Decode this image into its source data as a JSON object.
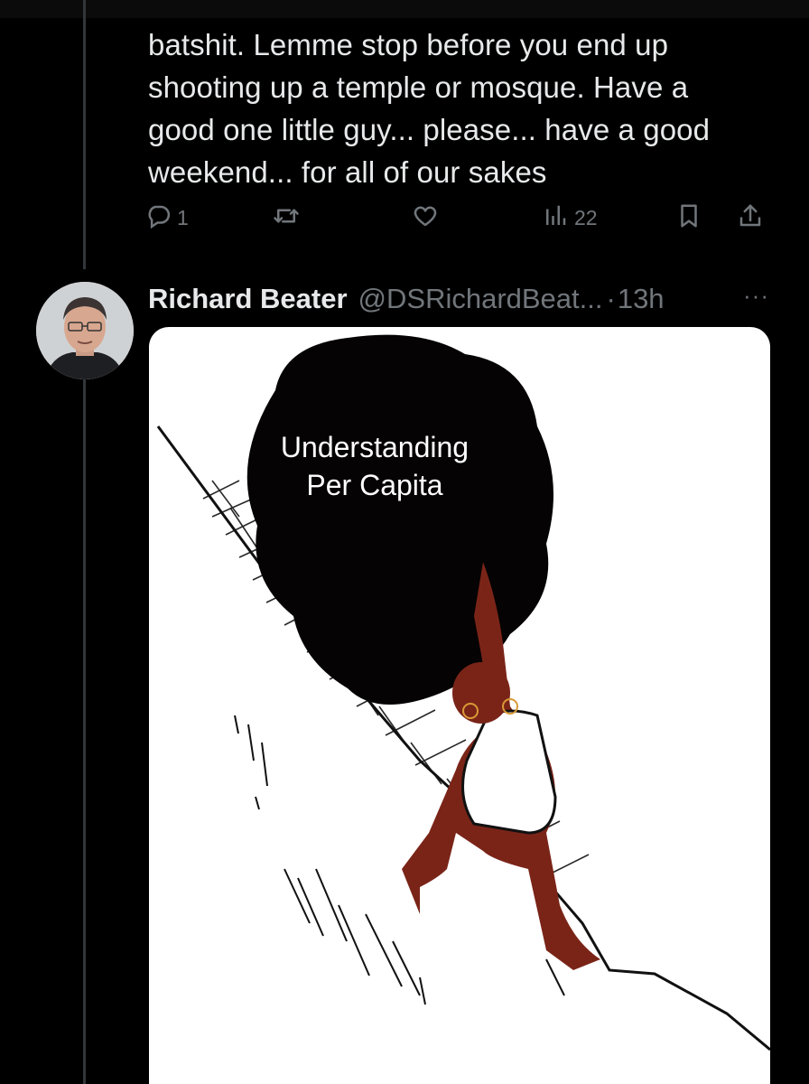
{
  "tweet": {
    "text": "batshit.  Lemme stop before you end up\nshooting up a temple or mosque. Have a\ngood one little guy... please... have a good\nweekend... for all of our sakes",
    "reply_count": "1",
    "views_count": "22",
    "icons": [
      "reply-icon",
      "retweet-icon",
      "like-icon",
      "views-icon",
      "bookmark-icon",
      "share-icon"
    ]
  },
  "reply": {
    "name": "Richard Beater",
    "handle": "@DSRichardBeat...",
    "separator": "·",
    "time": "13h",
    "more": "···",
    "image_caption": "Understanding\nPer Capita"
  },
  "colors": {
    "background": "#000000",
    "text": "#e7e9ea",
    "muted": "#71767b",
    "thread_line": "#333639"
  }
}
